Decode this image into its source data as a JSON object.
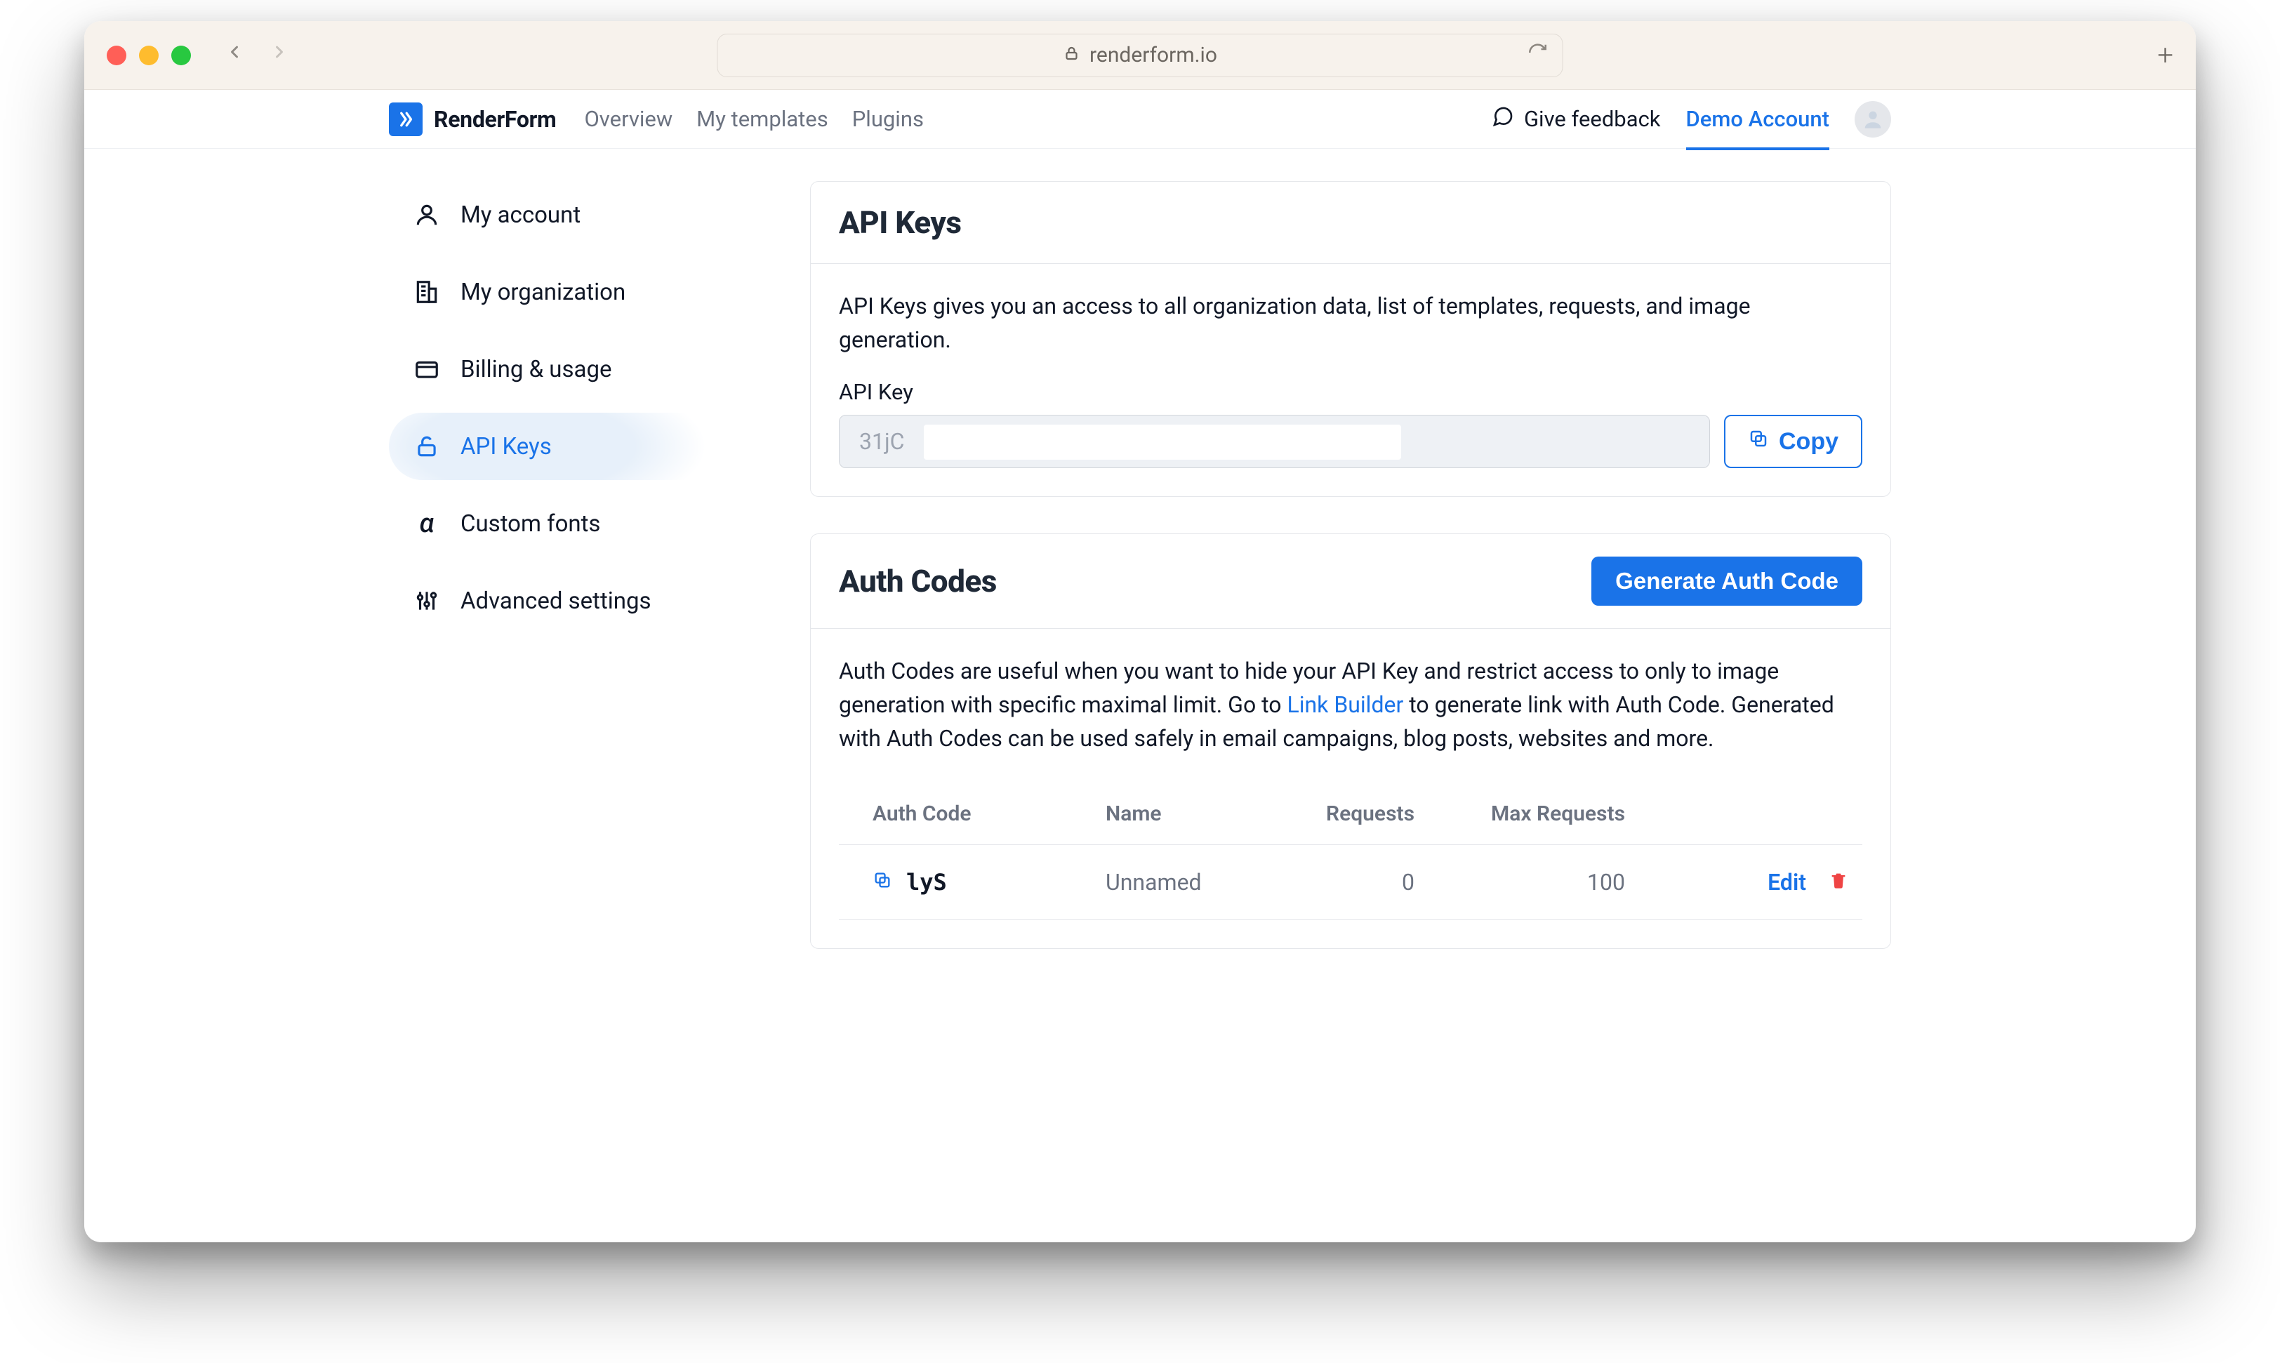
{
  "browser": {
    "url_host": "renderform.io"
  },
  "header": {
    "brand": "RenderForm",
    "nav": {
      "overview": "Overview",
      "my_templates": "My templates",
      "plugins": "Plugins"
    },
    "feedback": "Give feedback",
    "account": "Demo Account"
  },
  "sidebar": {
    "my_account": "My account",
    "my_organization": "My organization",
    "billing": "Billing & usage",
    "api_keys": "API Keys",
    "custom_fonts": "Custom fonts",
    "advanced": "Advanced settings"
  },
  "api_keys_card": {
    "title": "API Keys",
    "description": "API Keys gives you an access to all organization data, list of templates, requests, and image generation.",
    "field_label": "API Key",
    "value_preview": "31jC",
    "copy_label": "Copy"
  },
  "auth_codes_card": {
    "title": "Auth Codes",
    "generate_label": "Generate Auth Code",
    "desc_1": "Auth Codes are useful when you want to hide your API Key and restrict access to only to image generation with specific maximal limit. Go to ",
    "link_builder": "Link Builder",
    "desc_2": " to generate link with Auth Code. Generated with Auth Codes can be used safely in email campaigns, blog posts, websites and more.",
    "columns": {
      "auth_code": "Auth Code",
      "name": "Name",
      "requests": "Requests",
      "max_requests": "Max Requests"
    },
    "rows": [
      {
        "code_preview": "lyS",
        "name": "Unnamed",
        "requests": "0",
        "max_requests": "100",
        "edit": "Edit"
      }
    ]
  }
}
